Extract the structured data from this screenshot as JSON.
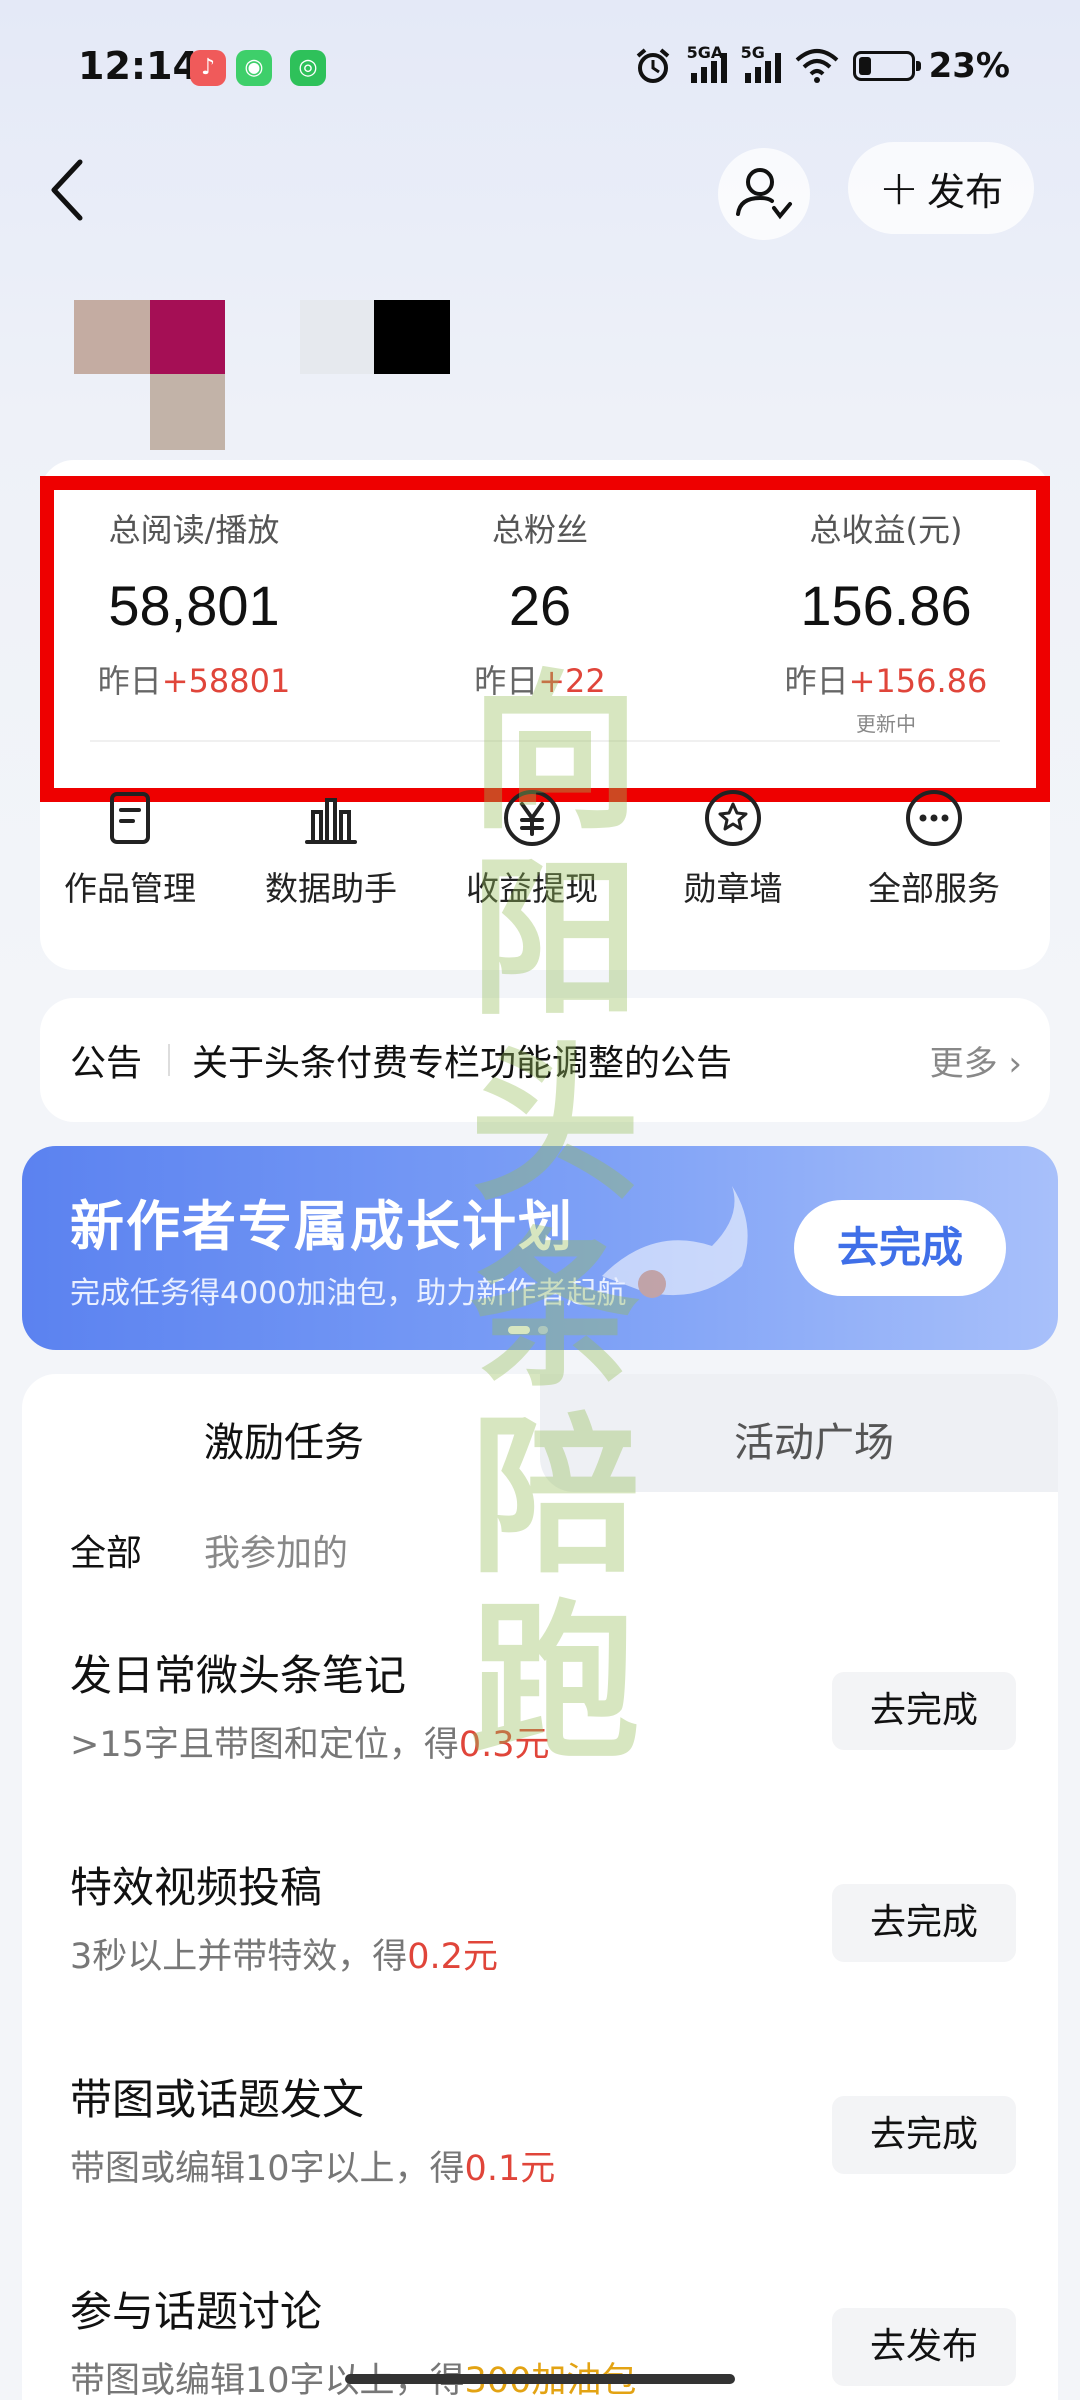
{
  "status_bar": {
    "time": "12:14",
    "net1": "5GA",
    "net2": "5G",
    "battery": "23%",
    "battery_level": 0.23
  },
  "header": {
    "publish_label": "发布"
  },
  "stats": [
    {
      "label": "总阅读/播放",
      "value": "58,801",
      "delta_prefix": "昨日",
      "delta": "+58801",
      "note": ""
    },
    {
      "label": "总粉丝",
      "value": "26",
      "delta_prefix": "昨日",
      "delta": "+22",
      "note": ""
    },
    {
      "label": "总收益(元)",
      "value": "156.86",
      "delta_prefix": "昨日",
      "delta": "+156.86",
      "note": "更新中"
    }
  ],
  "services": [
    {
      "label": "作品管理",
      "icon": "document-icon"
    },
    {
      "label": "数据助手",
      "icon": "bar-chart-icon"
    },
    {
      "label": "收益提现",
      "icon": "yuan-icon"
    },
    {
      "label": "勋章墙",
      "icon": "badge-icon"
    },
    {
      "label": "全部服务",
      "icon": "more-icon"
    }
  ],
  "notice": {
    "tag": "公告",
    "text": "关于头条付费专栏功能调整的公告",
    "more": "更多"
  },
  "banner": {
    "title": "新作者专属成长计划",
    "subtitle": "完成任务得4000加油包，助力新作者起航",
    "button": "去完成"
  },
  "task_tabs": {
    "active": "激励任务",
    "inactive": "活动广场"
  },
  "task_filters": [
    "全部",
    "我参加的"
  ],
  "tasks": [
    {
      "title": "发日常微头条笔记",
      "desc": ">15字且带图和定位，得",
      "reward": "0.3元",
      "button": "去完成"
    },
    {
      "title": "特效视频投稿",
      "desc": "3秒以上并带特效，得",
      "reward": "0.2元",
      "button": "去完成"
    },
    {
      "title": "带图或话题发文",
      "desc": "带图或编辑10字以上，得",
      "reward": "0.1元",
      "button": "去完成"
    },
    {
      "title": "参与话题讨论",
      "desc": "带图或编辑10字以上，得",
      "reward": "300加油包",
      "button": "去发布"
    }
  ],
  "watermark": [
    "向",
    "阳",
    "头",
    "条",
    "陪",
    "跑"
  ],
  "colors": {
    "highlight_border": "#ee0000",
    "delta_up": "#e0453a",
    "banner_blue": "#5b82f0",
    "reward_gold": "#e3a313"
  }
}
